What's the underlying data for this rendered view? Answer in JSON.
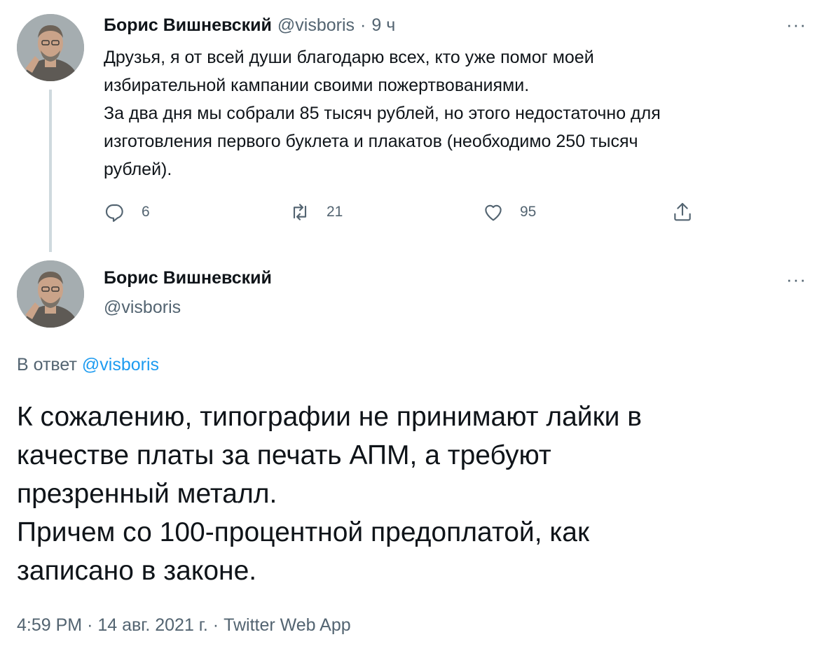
{
  "tweet1": {
    "name": "Борис Вишневский",
    "handle": "@visboris",
    "separator": "·",
    "time": "9 ч",
    "more": "···",
    "lines": [
      "Друзья, я от всей души благодарю всех, кто уже помог моей",
      "избирательной кампании своими пожертвованиями.",
      "За два дня мы собрали 85 тысяч рублей, но этого недостаточно для",
      "изготовления первого буклета и плакатов (необходимо 250 тысяч",
      "рублей)."
    ],
    "actions": {
      "reply_icon": "reply-icon",
      "reply_count": "6",
      "retweet_icon": "retweet-icon",
      "retweet_count": "21",
      "like_icon": "heart-icon",
      "like_count": "95",
      "share_icon": "share-icon"
    }
  },
  "tweet2": {
    "name": "Борис Вишневский",
    "handle": "@visboris",
    "more": "···",
    "reply_prefix": "В ответ",
    "reply_handle": "@visboris",
    "lines": [
      "К сожалению, типографии не принимают лайки в",
      "качестве платы за печать АПМ, а требуют",
      "презренный металл.",
      "Причем со 100-процентной предоплатой, как",
      "записано в законе."
    ],
    "meta": {
      "time": "4:59 PM",
      "sep1": "·",
      "date": "14 авг. 2021 г.",
      "sep2": "·",
      "app": "Twitter Web App"
    }
  },
  "colors": {
    "text": "#0f1419",
    "secondary": "#536471",
    "link": "#1d9bf0",
    "thread_line": "#cfd9de"
  }
}
